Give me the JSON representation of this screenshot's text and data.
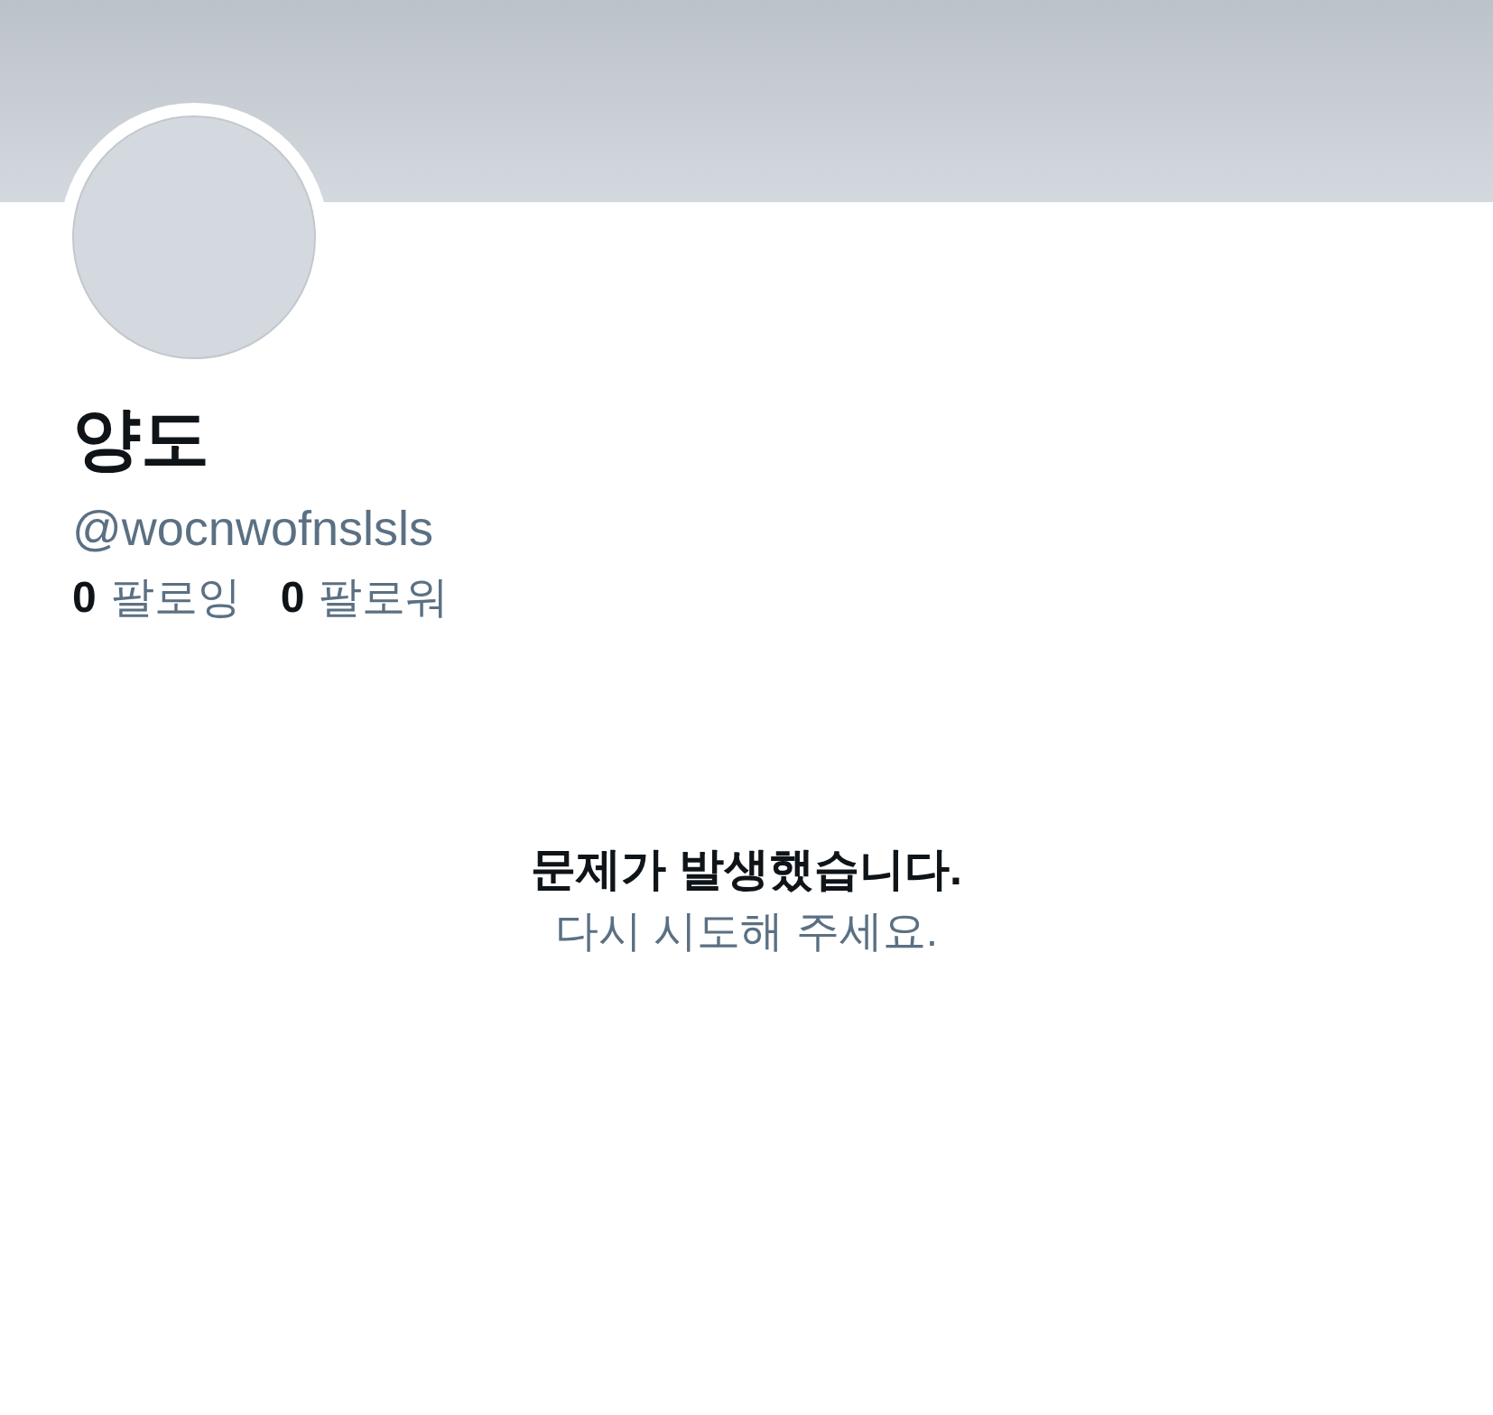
{
  "profile": {
    "name": "양도",
    "handle": "@wocnwofnslsls",
    "stats": [
      {
        "count": "0",
        "label": "팔로잉"
      },
      {
        "count": "0",
        "label": "팔로워"
      }
    ]
  },
  "error": {
    "title": "문제가 발생했습니다.",
    "message": "다시 시도해 주세요."
  }
}
